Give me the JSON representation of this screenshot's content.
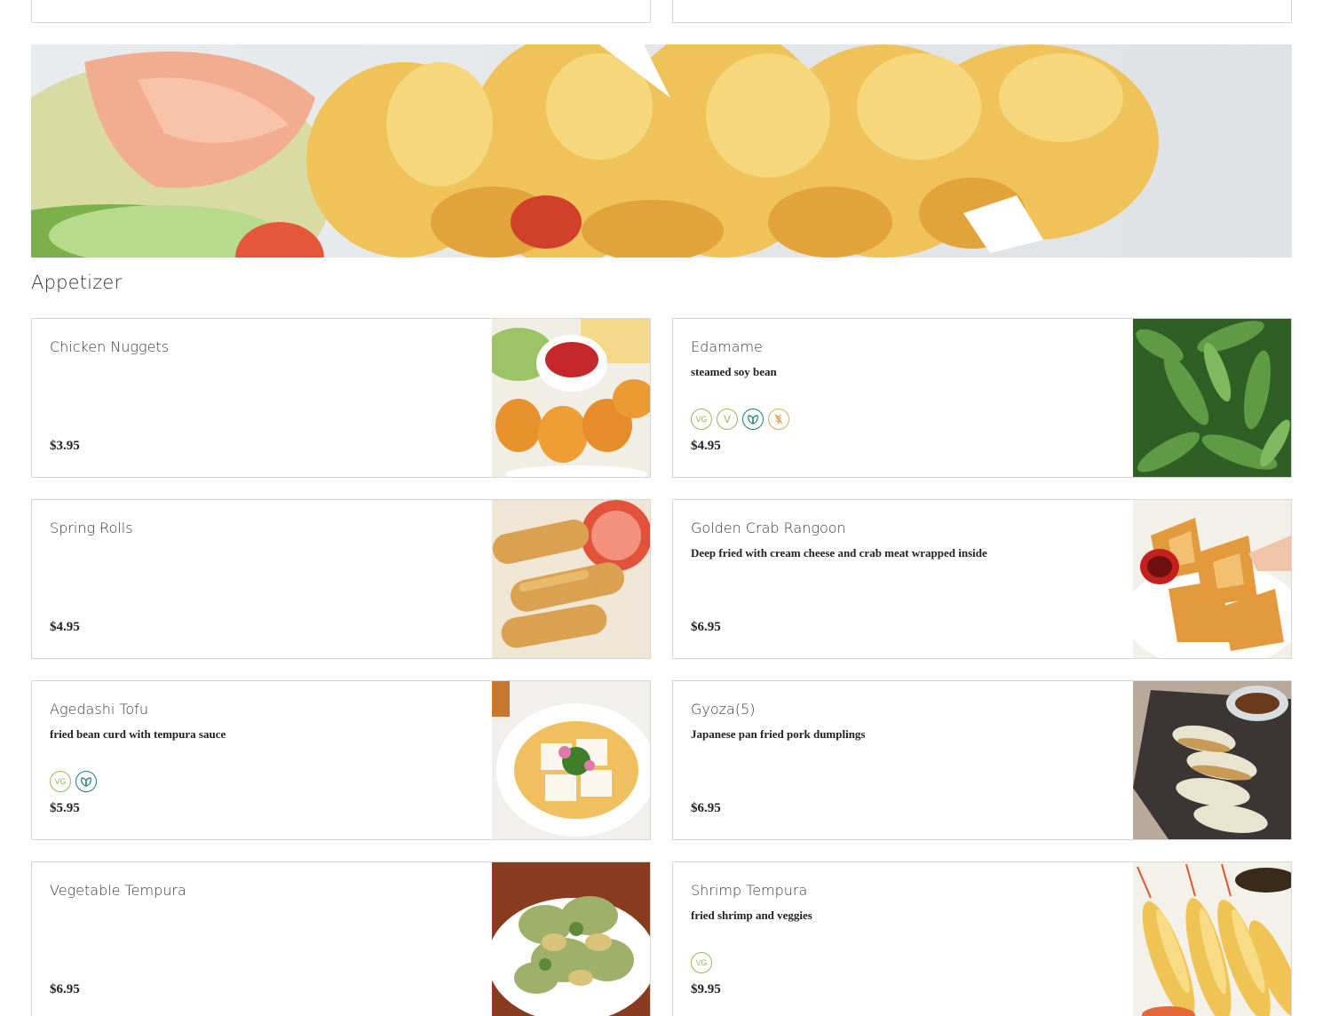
{
  "section": {
    "title": "Appetizer"
  },
  "items": [
    {
      "name": "Chicken Nuggets",
      "description": "",
      "price": "$3.95",
      "badges": [],
      "photo_icon": "chicken-nuggets-photo"
    },
    {
      "name": "Edamame",
      "description": "steamed soy bean",
      "price": "$4.95",
      "badges": [
        "VG",
        "V",
        "leaf",
        "wheat"
      ],
      "photo_icon": "edamame-photo"
    },
    {
      "name": "Spring Rolls",
      "description": "",
      "price": "$4.95",
      "badges": [],
      "photo_icon": "spring-rolls-photo"
    },
    {
      "name": "Golden Crab Rangoon",
      "description": "Deep fried with cream cheese and crab meat wrapped inside",
      "price": "$6.95",
      "badges": [],
      "photo_icon": "crab-rangoon-photo"
    },
    {
      "name": "Agedashi Tofu",
      "description": "fried bean curd with tempura sauce",
      "price": "$5.95",
      "badges": [
        "VG",
        "leaf"
      ],
      "photo_icon": "agedashi-tofu-photo"
    },
    {
      "name": "Gyoza(5)",
      "description": "Japanese pan fried pork dumplings",
      "price": "$6.95",
      "badges": [],
      "photo_icon": "gyoza-photo"
    },
    {
      "name": "Vegetable Tempura",
      "description": "",
      "price": "$6.95",
      "badges": [],
      "photo_icon": "vegetable-tempura-photo"
    },
    {
      "name": "Shrimp Tempura",
      "description": "fried shrimp and veggies",
      "price": "$9.95",
      "badges": [
        "VG"
      ],
      "photo_icon": "shrimp-tempura-photo"
    }
  ],
  "colors": {
    "border": "#d6d6d6",
    "vegan_badge": "#97b85c",
    "plant_badge": "#1f7d78",
    "gluten_badge": "#e0a85a"
  }
}
